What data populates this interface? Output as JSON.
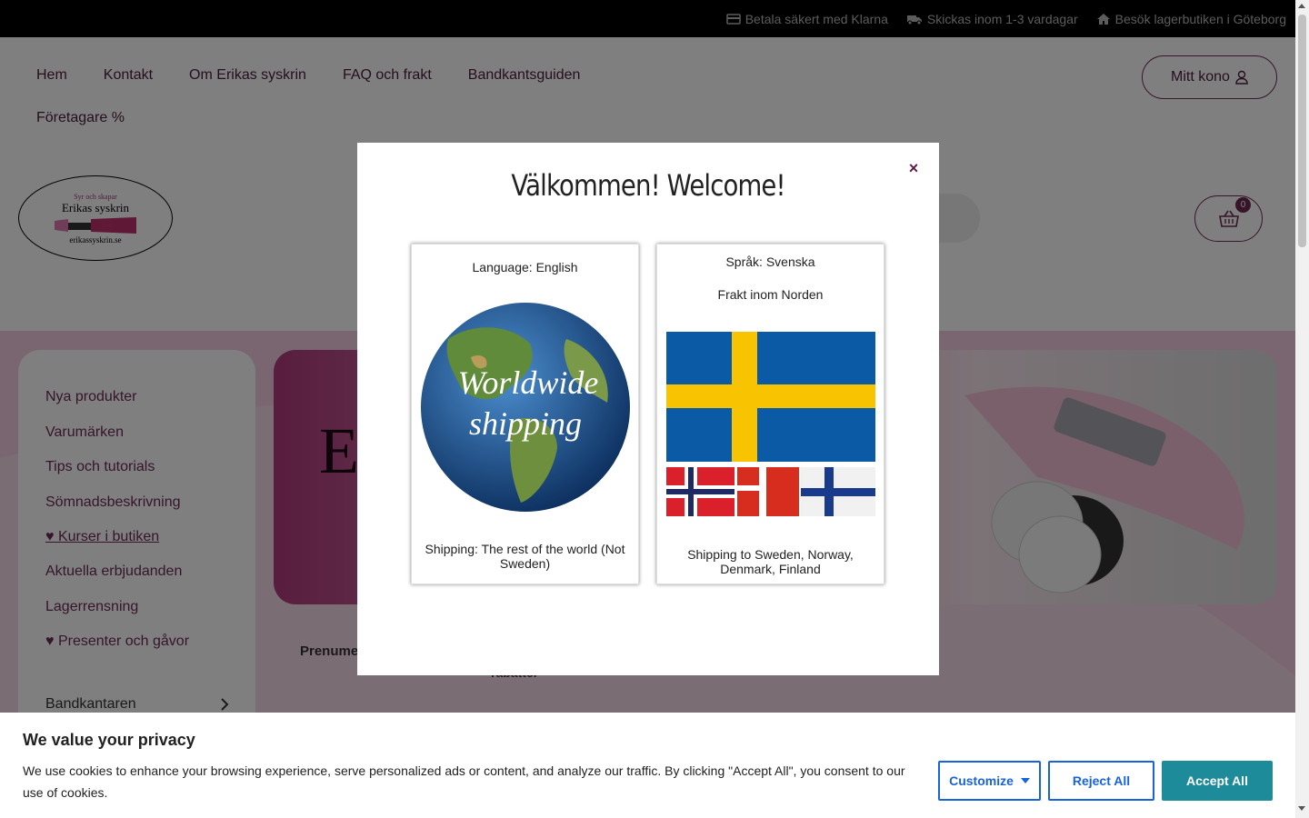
{
  "topbar": {
    "items": [
      {
        "icon": "credit-card-icon",
        "label": "Betala säkert med Klarna"
      },
      {
        "icon": "truck-icon",
        "label": "Skickas inom 1-3 vardagar"
      },
      {
        "icon": "home-icon",
        "label": "Besök lagerbutiken i Göteborg"
      }
    ]
  },
  "nav": {
    "items": [
      "Hem",
      "Kontakt",
      "Om Erikas syskrin",
      "FAQ och frakt",
      "Bandkantsguiden"
    ],
    "second_row": "Företagare %",
    "account_label": "Mitt kono",
    "cart_count": "0"
  },
  "logo": {
    "top": "Syr och skapar",
    "name": "Erikas syskrin",
    "url": "erikassyskrin.se"
  },
  "sidebar": {
    "items": [
      "Nya produkter",
      "Varumärken",
      "Tips och tutorials",
      "Sömnadsbeskrivning",
      "♥ Kurser i butiken",
      "Aktuella erbjudanden",
      "Lagerrensning",
      "♥ Presenter och gåvor",
      "Bandkantaren"
    ]
  },
  "hero": {
    "letter": "E"
  },
  "main": {
    "subscribe_partial": "Prenume",
    "discount_partial": "rabatter"
  },
  "modal": {
    "title": "Välkommen! Welcome!",
    "close": "×",
    "english": {
      "language": "Language: English",
      "globe_line1": "Worldwide",
      "globe_line2": "shipping",
      "shipping": "Shipping: The rest of the world (Not Sweden)"
    },
    "swedish": {
      "language": "Språk: Svenska",
      "shipping_region": "Frakt inom Norden",
      "shipping": "Shipping to Sweden, Norway, Denmark, Finland"
    }
  },
  "cookie": {
    "title": "We value your privacy",
    "text": "We use cookies to enhance your browsing experience, serve personalized ads or content, and analyze our traffic. By clicking \"Accept All\", you consent to our use of cookies.",
    "customize": "Customize",
    "reject": "Reject All",
    "accept": "Accept All"
  },
  "colors": {
    "brand": "#6c2b57",
    "pink_bg": "#f3cce0",
    "accept": "#1e8b9a",
    "link_blue": "#1863dc"
  }
}
